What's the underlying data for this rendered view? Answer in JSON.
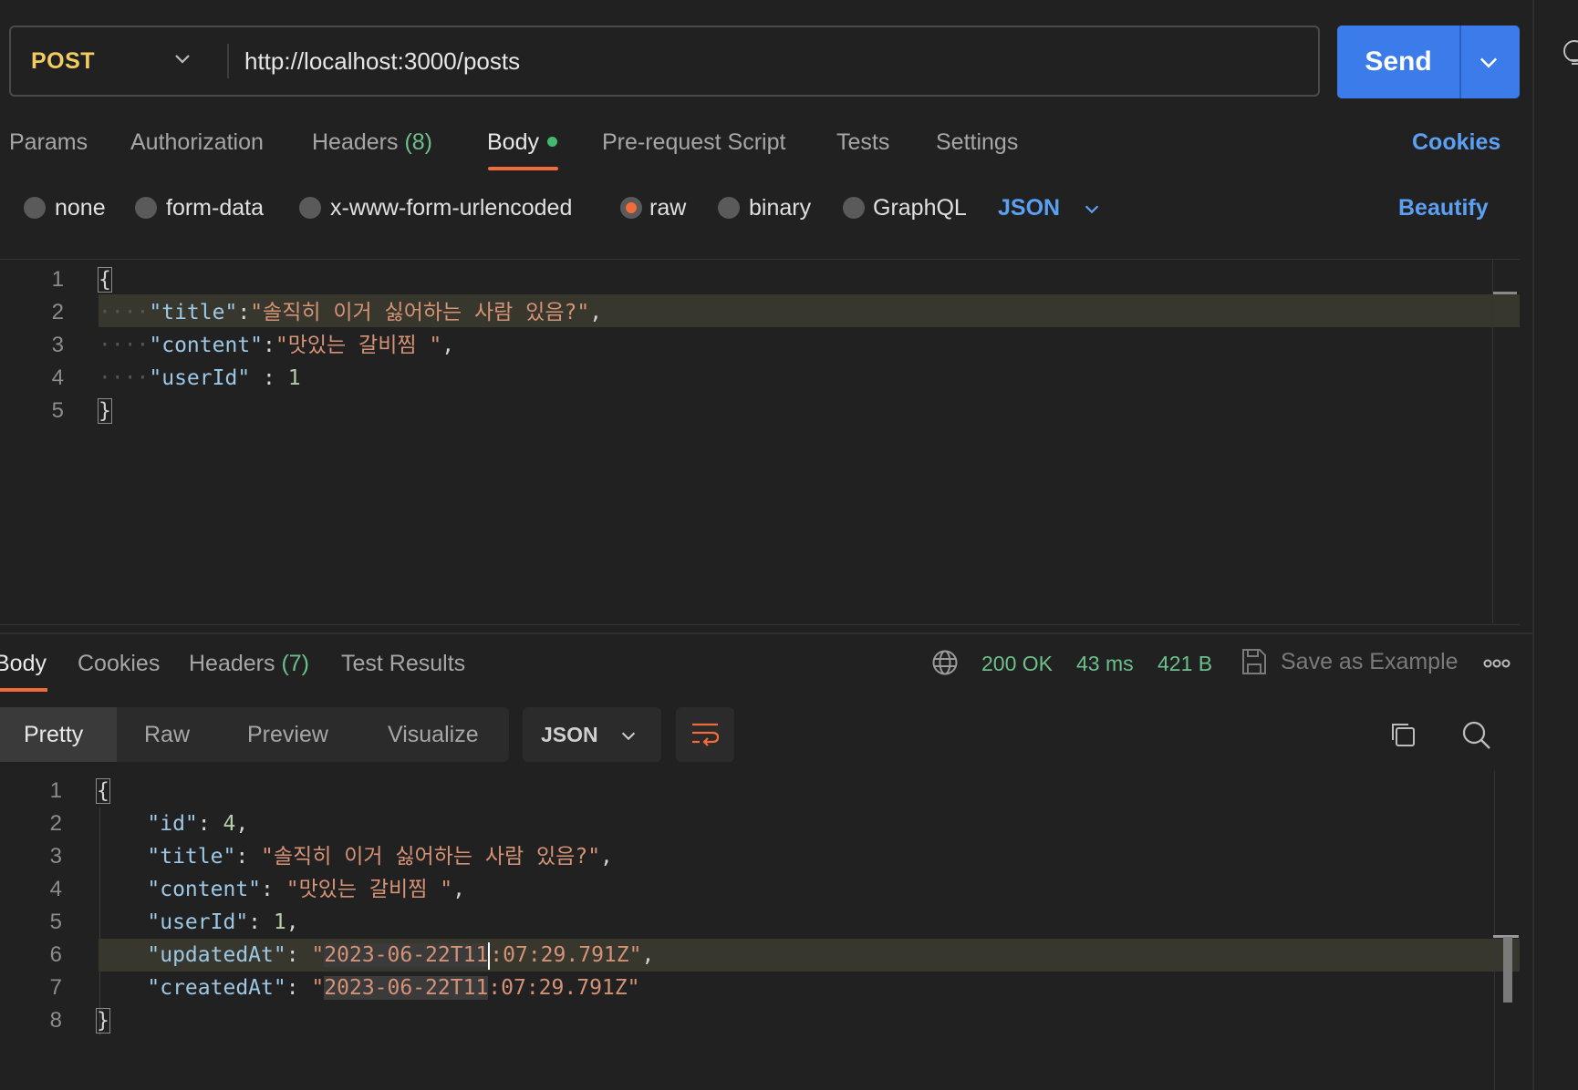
{
  "request": {
    "method": "POST",
    "url": "http://localhost:3000/posts",
    "send_label": "Send"
  },
  "request_tabs": {
    "params": "Params",
    "authorization": "Authorization",
    "headers": "Headers",
    "headers_count": "(8)",
    "body": "Body",
    "pre_request": "Pre-request Script",
    "tests": "Tests",
    "settings": "Settings",
    "cookies": "Cookies"
  },
  "body_types": {
    "none": "none",
    "form_data": "form-data",
    "urlencoded": "x-www-form-urlencoded",
    "raw": "raw",
    "binary": "binary",
    "graphql": "GraphQL",
    "selected": "raw",
    "language": "JSON",
    "beautify": "Beautify"
  },
  "request_body": {
    "line_numbers": [
      "1",
      "2",
      "3",
      "4",
      "5"
    ],
    "open_brace": "{",
    "close_brace": "}",
    "title_key": "\"title\"",
    "title_value": "\"솔직히 이거 싫어하는 사람 있음?\"",
    "content_key": "\"content\"",
    "content_value": "\"맛있는 갈비찜 \"",
    "userid_key": "\"userId\"",
    "userid_value": "1"
  },
  "response_tabs": {
    "body": "Body",
    "cookies": "Cookies",
    "headers": "Headers",
    "headers_count": "(7)",
    "test_results": "Test Results"
  },
  "response_status": {
    "status": "200 OK",
    "time": "43 ms",
    "size": "421 B",
    "save_as_example": "Save as Example"
  },
  "response_view": {
    "pretty": "Pretty",
    "raw": "Raw",
    "preview": "Preview",
    "visualize": "Visualize",
    "format": "JSON"
  },
  "response_body": {
    "line_numbers": [
      "1",
      "2",
      "3",
      "4",
      "5",
      "6",
      "7",
      "8"
    ],
    "open_brace": "{",
    "close_brace": "}",
    "id_key": "\"id\"",
    "id_value": "4",
    "title_key": "\"title\"",
    "title_value": "\"솔직히 이거 싫어하는 사람 있음?\"",
    "content_key": "\"content\"",
    "content_value": "\"맛있는 갈비찜 \"",
    "userid_key": "\"userId\"",
    "userid_value": "1",
    "updated_key": "\"updatedAt\"",
    "updated_sel": "2023-06-22T11",
    "updated_rest": ":07:29.791Z\"",
    "created_key": "\"createdAt\"",
    "created_sel": "2023-06-22T11",
    "created_rest": ":07:29.791Z\""
  },
  "colors": {
    "method": "#f2cc60",
    "send": "#3b7bea",
    "accent": "#f26b3a",
    "link": "#5ba0f2",
    "success": "#6cc08b"
  }
}
